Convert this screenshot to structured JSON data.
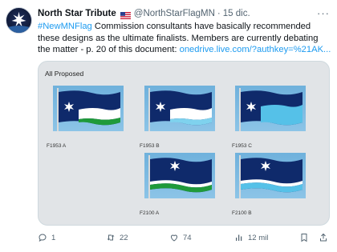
{
  "author": {
    "name": "North Star Tribute",
    "handle": "@NorthStarFlagMN",
    "separator": "·",
    "date": "15 dic."
  },
  "tweet": {
    "hashtag": "#NewMNFlag",
    "body": " Commission consultants have basically recommended these designs as the ultimate finalists. Members are currently debating the matter - p. 20 of this document: ",
    "link": "onedrive.live.com/?authkey=%21AK..."
  },
  "card": {
    "title": "All Proposed",
    "flags": [
      {
        "label": "F1953 A",
        "bottom_color": "#1f9a3a",
        "band_color": "#ffffff"
      },
      {
        "label": "F1953 B",
        "bottom_color": "#7fd2ee",
        "band_color": "#ffffff"
      },
      {
        "label": "F1953 C",
        "bottom_color": "#55c1e8",
        "band_color": "#55c1e8"
      },
      {
        "label": "F2100 A",
        "bottom_color": "#1f9a3a",
        "band_color": "#ffffff"
      },
      {
        "label": "F2100 B",
        "bottom_color": "#55c1e8",
        "band_color": "#ffffff"
      }
    ]
  },
  "actions": {
    "replies": "1",
    "retweets": "22",
    "likes": "74",
    "views": "12 mil"
  },
  "colors": {
    "accent": "#1d9bf0",
    "navy": "#0f2a6b",
    "muted": "#536471"
  }
}
